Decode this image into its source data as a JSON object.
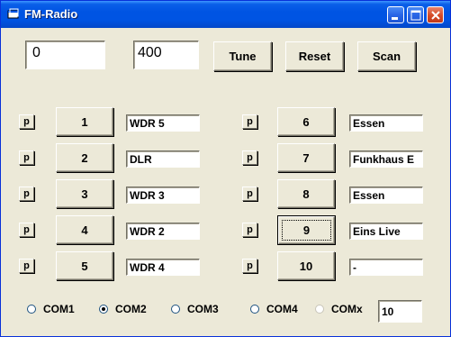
{
  "window": {
    "title": "FM-Radio"
  },
  "top": {
    "frequency_value": "0",
    "step_value": "400",
    "tune_label": "Tune",
    "reset_label": "Reset",
    "scan_label": "Scan"
  },
  "presets_left": [
    {
      "p": "p",
      "num": "1",
      "station": "WDR 5"
    },
    {
      "p": "p",
      "num": "2",
      "station": "DLR"
    },
    {
      "p": "p",
      "num": "3",
      "station": "WDR 3"
    },
    {
      "p": "p",
      "num": "4",
      "station": "WDR 2"
    },
    {
      "p": "p",
      "num": "5",
      "station": "WDR 4"
    }
  ],
  "presets_right": [
    {
      "p": "p",
      "num": "6",
      "station": "Essen"
    },
    {
      "p": "p",
      "num": "7",
      "station": "Funkhaus E"
    },
    {
      "p": "p",
      "num": "8",
      "station": "Essen"
    },
    {
      "p": "p",
      "num": "9",
      "station": "Eins Live"
    },
    {
      "p": "p",
      "num": "10",
      "station": "-"
    }
  ],
  "ports": {
    "com1": "COM1",
    "com2": "COM2",
    "com3": "COM3",
    "com4": "COM4",
    "comx": "COMx",
    "comx_value": "10",
    "selected": "COM2"
  },
  "colors": {
    "titlebar": "#0054e3",
    "face": "#ece9d8"
  }
}
